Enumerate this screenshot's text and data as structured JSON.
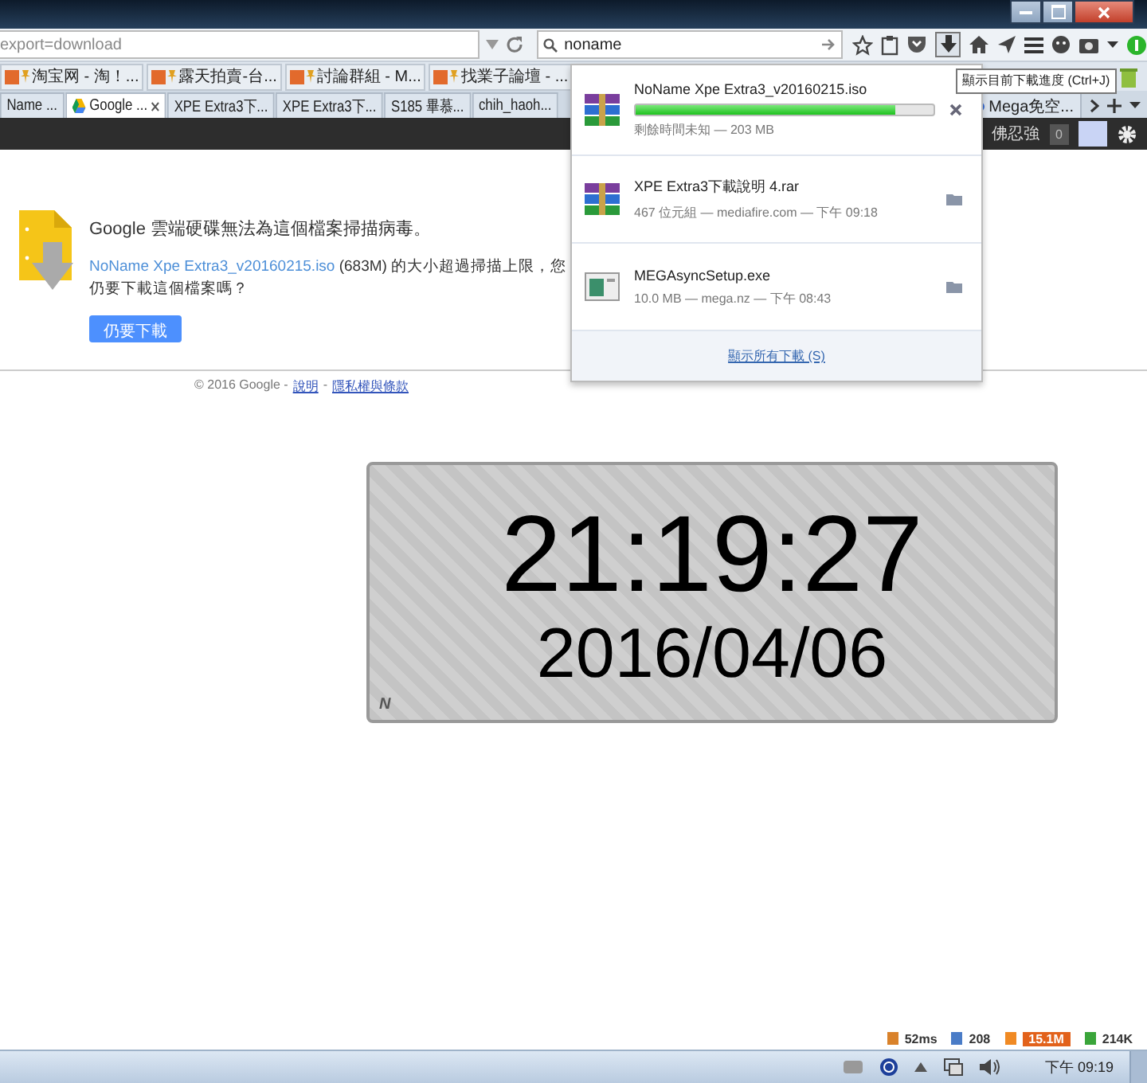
{
  "address_bar": {
    "value": "export=download"
  },
  "search_field": {
    "value": "noname"
  },
  "bookmarks": [
    "淘宝网 - 淘！...",
    "露天拍賣-台...",
    "討論群組 - M...",
    "找業子論壇 - ..."
  ],
  "tabs": [
    {
      "label": "Name ...",
      "selected": false
    },
    {
      "label": "Google ...",
      "selected": true
    },
    {
      "label": "XPE Extra3下...",
      "selected": false
    },
    {
      "label": "XPE Extra3下...",
      "selected": false
    },
    {
      "label": "S185 畢慕...",
      "selected": false
    },
    {
      "label": "chih_haoh...",
      "selected": false
    },
    {
      "label": "Mega免空...",
      "selected": false
    }
  ],
  "account_bar": {
    "user": "佛忍強",
    "count": "0"
  },
  "page": {
    "heading": "Google 雲端硬碟無法為這個檔案掃描病毒。",
    "link": "NoName Xpe Extra3_v20160215.iso",
    "message": "(683M) 的大小超過掃描上限，您仍要下載這個檔案嗎？",
    "button": "仍要下載",
    "footer_text": "© 2016 Google -",
    "footer_separator": "-",
    "footer_links": [
      "說明",
      "隱私權與條款"
    ]
  },
  "downloads": {
    "items": [
      {
        "kind": "archive",
        "name": "NoName Xpe Extra3_v20160215.iso",
        "status": "剩餘時間未知 — 203 MB",
        "level": 0.87
      },
      {
        "kind": "archive",
        "name": "XPE Extra3下載說明 4.rar",
        "status": "467 位元組 — mediafire.com — 下午 09:18"
      },
      {
        "kind": "program",
        "name": "MEGAsyncSetup.exe",
        "status": "10.0 MB — mega.nz — 下午 08:43"
      }
    ],
    "footer": "顯示所有下載 (S)"
  },
  "tooltip": "顯示目前下載進度 (Ctrl+J)",
  "clock": {
    "time": "21:19:27",
    "date": "2016/04/06",
    "corner": "N"
  },
  "meters": [
    "52ms",
    "208",
    "15.1M",
    "214K"
  ],
  "taskbar": {
    "time": "下午 09:19"
  }
}
